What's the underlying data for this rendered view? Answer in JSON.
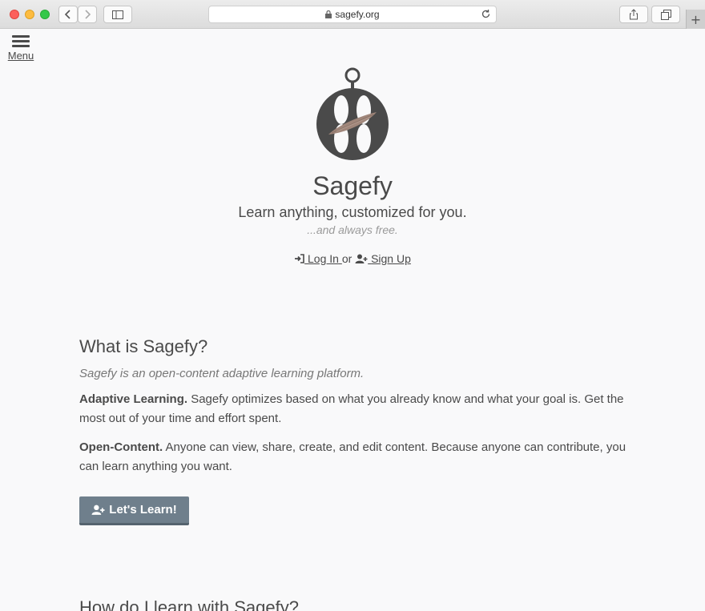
{
  "browser": {
    "url": "sagefy.org",
    "new_tab_label": "+"
  },
  "menu": {
    "label": "Menu"
  },
  "hero": {
    "brand": "Sagefy",
    "tagline": "Learn anything, customized for you.",
    "subtagline": "...and always free.",
    "login_label": "Log In",
    "or_label": "or",
    "signup_label": "Sign Up"
  },
  "about": {
    "heading": "What is Sagefy?",
    "lead": "Sagefy is an open-content adaptive learning platform.",
    "adaptive_title": "Adaptive Learning.",
    "adaptive_text": "Sagefy optimizes based on what you already know and what your goal is. Get the most out of your time and effort spent.",
    "open_title": "Open-Content.",
    "open_text": "Anyone can view, share, create, and edit content. Because anyone can contribute, you can learn anything you want."
  },
  "cta": {
    "label": "Let's Learn!"
  },
  "how": {
    "heading": "How do I learn with Sagefy?"
  },
  "colors": {
    "button": "#6f7f8c",
    "text": "#4a4a4a",
    "logo": "#4a4a4a",
    "logo_accent": "#a0867a"
  }
}
